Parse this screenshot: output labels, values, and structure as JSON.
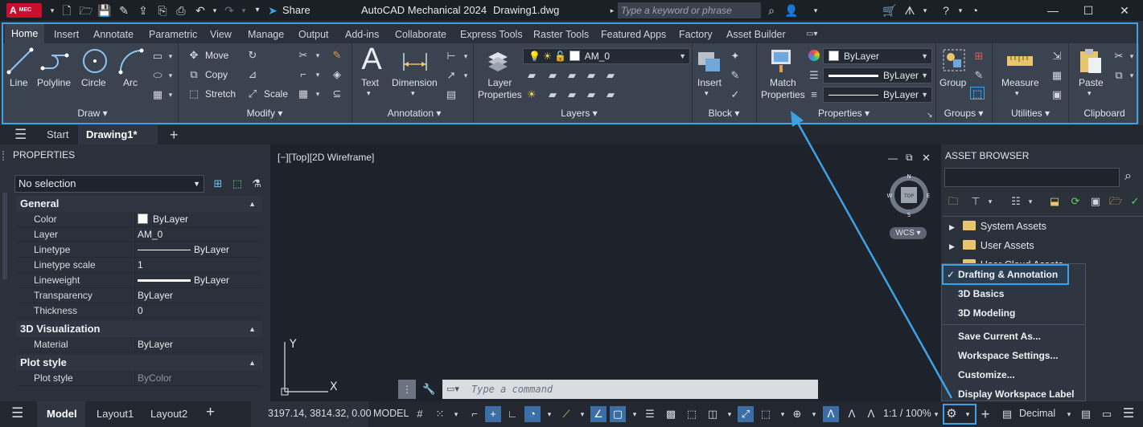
{
  "titlebar": {
    "app_badge": "A",
    "app_badge_sub": "MEC",
    "share_label": "Share",
    "app_title": "AutoCAD Mechanical 2024",
    "doc_title": "Drawing1.dwg",
    "search_placeholder": "Type a keyword or phrase"
  },
  "ribbon": {
    "tabs": [
      "Home",
      "Insert",
      "Annotate",
      "Parametric",
      "View",
      "Manage",
      "Output",
      "Add-ins",
      "Collaborate",
      "Express Tools",
      "Raster Tools",
      "Featured Apps",
      "Factory",
      "Asset Builder"
    ],
    "draw": {
      "title": "Draw",
      "line": "Line",
      "polyline": "Polyline",
      "circle": "Circle",
      "arc": "Arc"
    },
    "modify": {
      "title": "Modify",
      "move": "Move",
      "copy": "Copy",
      "stretch": "Stretch",
      "scale": "Scale"
    },
    "annotation": {
      "title": "Annotation",
      "text": "Text",
      "dimension": "Dimension"
    },
    "layers": {
      "title": "Layers",
      "layer_properties_line1": "Layer",
      "layer_properties_line2": "Properties",
      "current_layer": "AM_0"
    },
    "block": {
      "title": "Block",
      "insert": "Insert"
    },
    "properties": {
      "title": "Properties",
      "match_line1": "Match",
      "match_line2": "Properties",
      "color": "ByLayer",
      "linetype": "ByLayer",
      "lineweight": "ByLayer"
    },
    "groups": {
      "title": "Groups",
      "group": "Group"
    },
    "utilities": {
      "title": "Utilities",
      "measure": "Measure"
    },
    "clipboard": {
      "title": "Clipboard",
      "paste": "Paste"
    }
  },
  "doc_tabs": {
    "start": "Start",
    "drawing": "Drawing1*"
  },
  "properties_panel": {
    "title": "PROPERTIES",
    "selection": "No selection",
    "general_title": "General",
    "general": [
      {
        "key": "Color",
        "value": "ByLayer"
      },
      {
        "key": "Layer",
        "value": "AM_0"
      },
      {
        "key": "Linetype",
        "value": "ByLayer"
      },
      {
        "key": "Linetype scale",
        "value": "1"
      },
      {
        "key": "Lineweight",
        "value": "ByLayer"
      },
      {
        "key": "Transparency",
        "value": "ByLayer"
      },
      {
        "key": "Thickness",
        "value": "0"
      }
    ],
    "viz_title": "3D Visualization",
    "viz": [
      {
        "key": "Material",
        "value": "ByLayer"
      }
    ],
    "plot_title": "Plot style",
    "plot": [
      {
        "key": "Plot style",
        "value": "ByColor"
      }
    ]
  },
  "viewport": {
    "label": "[−][Top][2D Wireframe]",
    "wcs": "WCS",
    "cube_top": "TOP",
    "compass_n": "N",
    "compass_s": "S",
    "compass_e": "E",
    "compass_w": "W",
    "axis_x": "X",
    "axis_y": "Y",
    "command_placeholder": "Type a command"
  },
  "asset_browser": {
    "title": "ASSET BROWSER",
    "items": [
      "System Assets",
      "User Assets",
      "User Cloud Assets"
    ]
  },
  "workspace_menu": {
    "checked": "Drafting & Annotation",
    "items": [
      "3D Basics",
      "3D Modeling"
    ],
    "actions": [
      "Save Current As...",
      "Workspace Settings...",
      "Customize...",
      "Display Workspace Label"
    ]
  },
  "statusbar": {
    "model_tab": "Model",
    "layout1": "Layout1",
    "layout2": "Layout2",
    "coords": "3197.14, 3814.32, 0.00",
    "model_btn": "MODEL",
    "scale": "1:1 / 100%",
    "units": "Decimal"
  },
  "colors": {
    "accent": "#3ea1e3",
    "ribbon_bg": "#3b4350",
    "app_red": "#c8102e"
  }
}
